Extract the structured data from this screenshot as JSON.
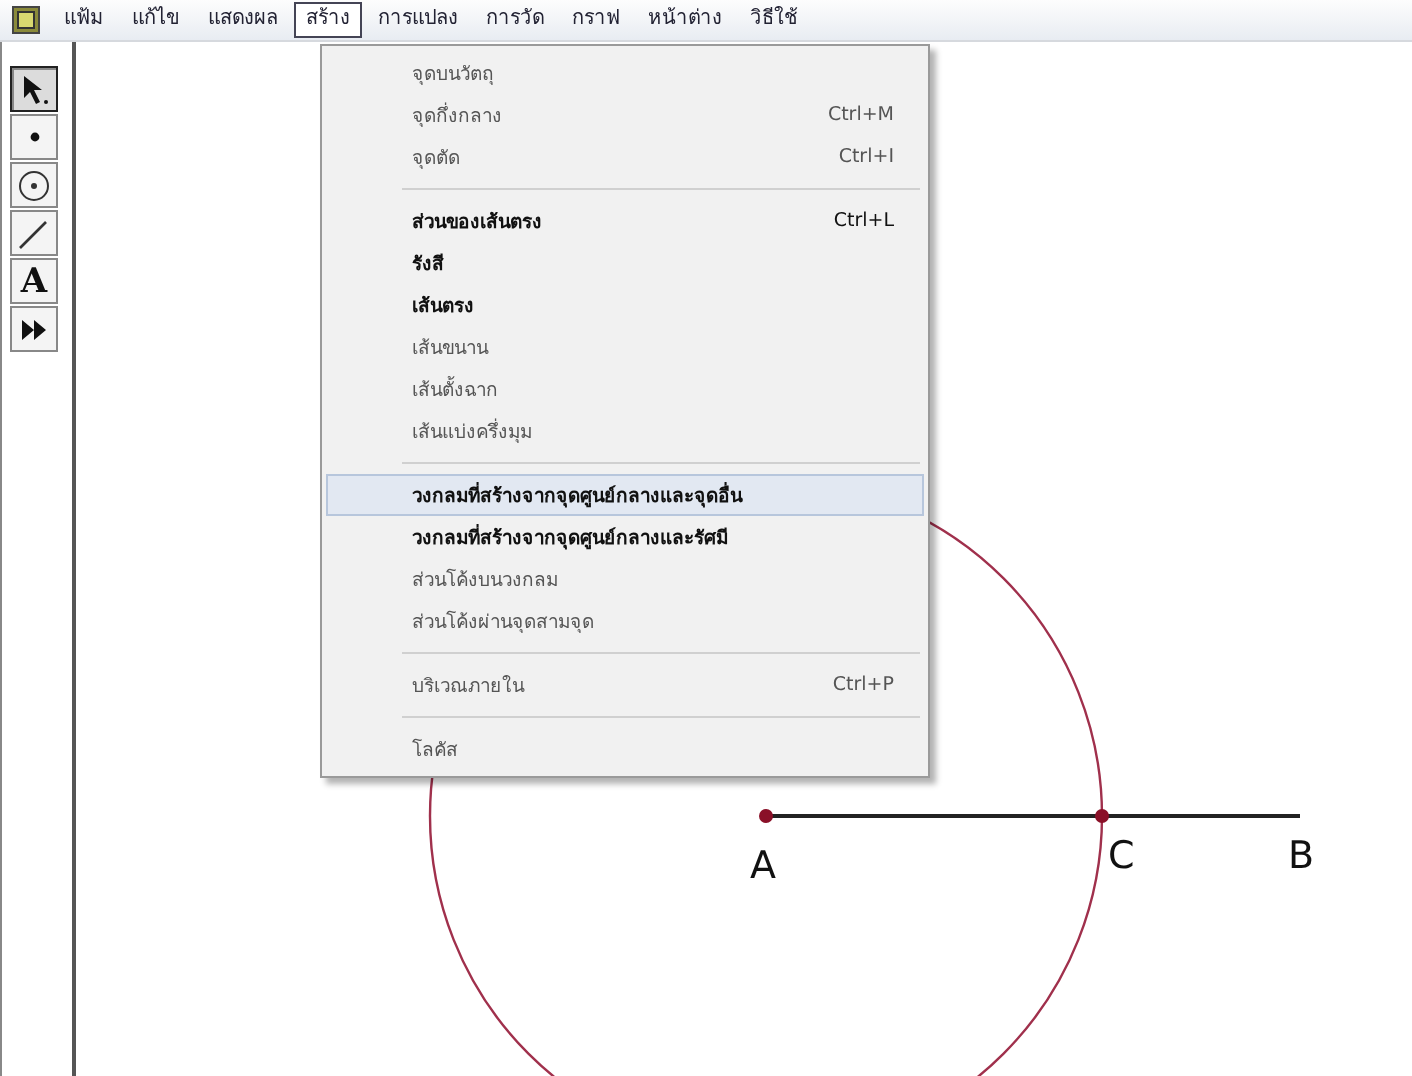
{
  "menu_bar": [
    {
      "label": "แฟ้ม",
      "selected": false
    },
    {
      "label": "แก้ไข",
      "selected": false
    },
    {
      "label": "แสดงผล",
      "selected": false
    },
    {
      "label": "สร้าง",
      "selected": true
    },
    {
      "label": "การแปลง",
      "selected": false
    },
    {
      "label": "การวัด",
      "selected": false
    },
    {
      "label": "กราฟ",
      "selected": false
    },
    {
      "label": "หน้าต่าง",
      "selected": false
    },
    {
      "label": "วิธีใช้",
      "selected": false
    }
  ],
  "toolbox": [
    {
      "kind": "arrow",
      "selected": true
    },
    {
      "kind": "point",
      "selected": false
    },
    {
      "kind": "compass",
      "selected": false
    },
    {
      "kind": "straightedge",
      "selected": false
    },
    {
      "kind": "text",
      "glyph": "A",
      "selected": false
    },
    {
      "kind": "custom",
      "selected": false
    }
  ],
  "construct_menu": [
    {
      "kind": "item",
      "label": "จุดบนวัตถุ",
      "disabled": true,
      "selected": false
    },
    {
      "kind": "item",
      "label": "จุดกึ่งกลาง",
      "shortcut": "Ctrl+M",
      "disabled": true,
      "selected": false
    },
    {
      "kind": "item",
      "label": "จุดตัด",
      "shortcut": "Ctrl+I",
      "disabled": true,
      "selected": false
    },
    {
      "kind": "separator"
    },
    {
      "kind": "item",
      "label": "ส่วนของเส้นตรง",
      "shortcut": "Ctrl+L",
      "disabled": false,
      "selected": false
    },
    {
      "kind": "item",
      "label": "รังสี",
      "disabled": false,
      "selected": false
    },
    {
      "kind": "item",
      "label": "เส้นตรง",
      "disabled": false,
      "selected": false
    },
    {
      "kind": "item",
      "label": "เส้นขนาน",
      "disabled": true,
      "selected": false
    },
    {
      "kind": "item",
      "label": "เส้นตั้งฉาก",
      "disabled": true,
      "selected": false
    },
    {
      "kind": "item",
      "label": "เส้นแบ่งครึ่งมุม",
      "disabled": true,
      "selected": false
    },
    {
      "kind": "separator"
    },
    {
      "kind": "item",
      "label": "วงกลมที่สร้างจากจุดศูนย์กลางและจุดอื่น",
      "disabled": false,
      "selected": true
    },
    {
      "kind": "item",
      "label": "วงกลมที่สร้างจากจุดศูนย์กลางและรัศมี",
      "disabled": false,
      "selected": false
    },
    {
      "kind": "item",
      "label": "ส่วนโค้งบนวงกลม",
      "disabled": true,
      "selected": false
    },
    {
      "kind": "item",
      "label": "ส่วนโค้งผ่านจุดสามจุด",
      "disabled": true,
      "selected": false
    },
    {
      "kind": "separator"
    },
    {
      "kind": "item",
      "label": "บริเวณภายใน",
      "shortcut": "Ctrl+P",
      "disabled": true,
      "selected": false
    },
    {
      "kind": "separator"
    },
    {
      "kind": "item",
      "label": "โลคัส",
      "disabled": true,
      "selected": false
    }
  ],
  "sketch": {
    "point_labels": [
      "A",
      "C",
      "B"
    ]
  }
}
